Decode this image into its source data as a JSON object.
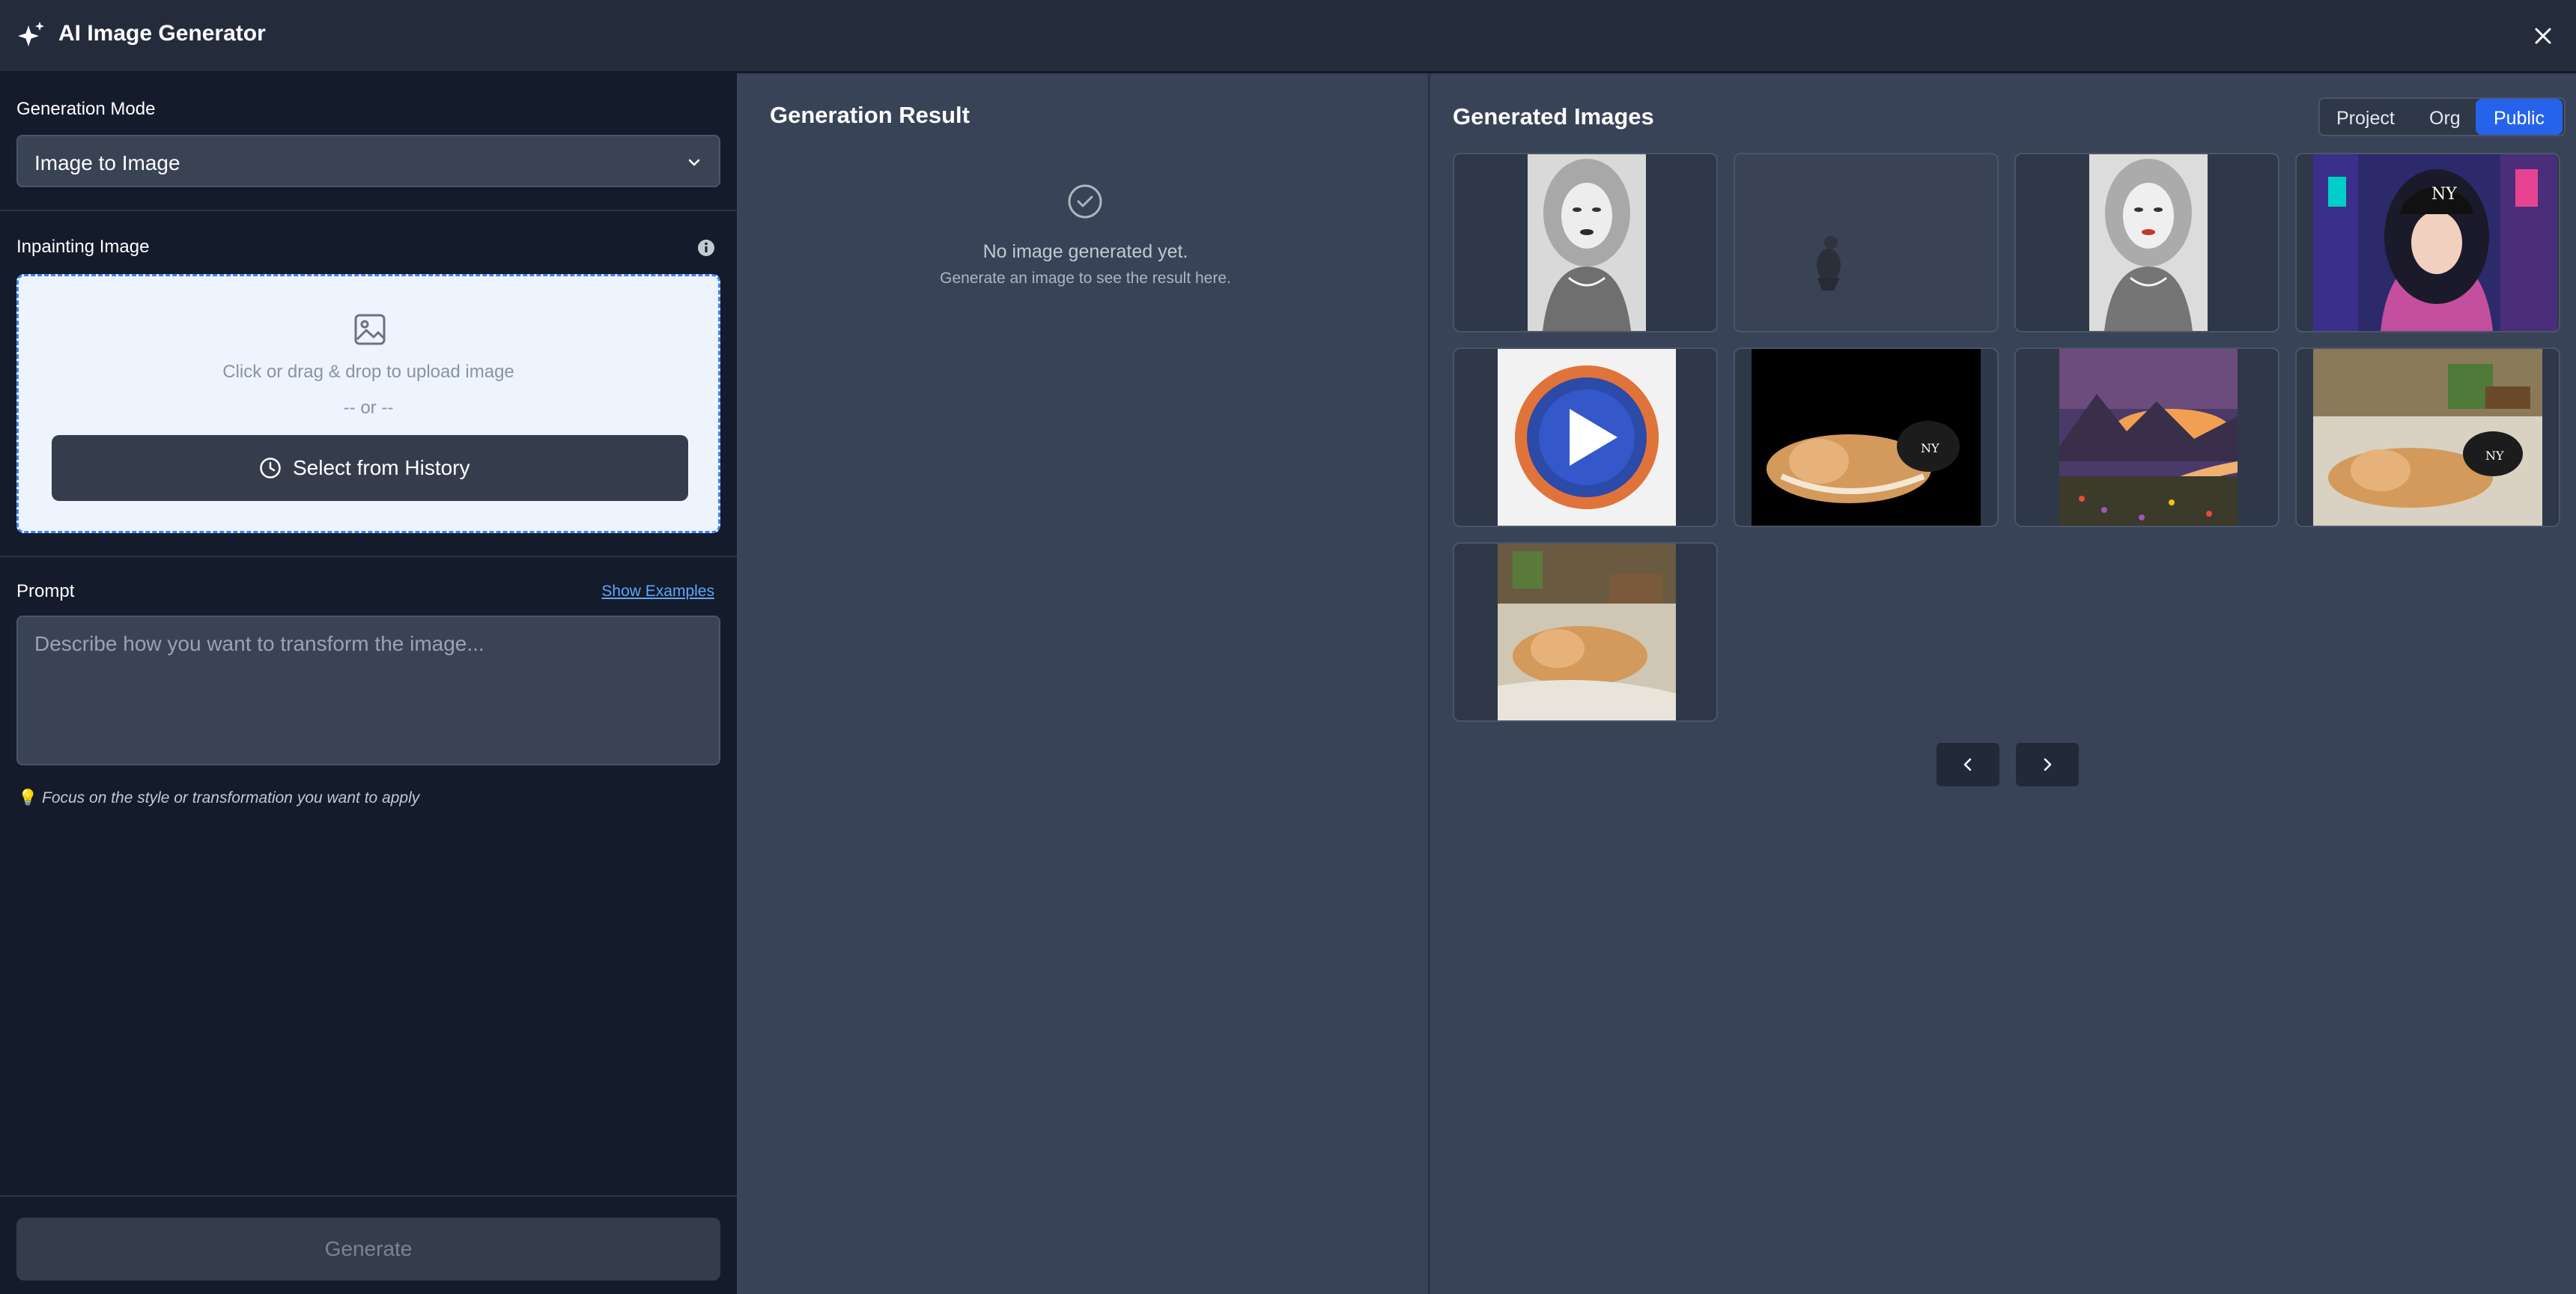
{
  "header": {
    "title": "AI Image Generator"
  },
  "left_panel": {
    "mode_label": "Generation Mode",
    "mode_value": "Image to Image",
    "inpainting_label": "Inpainting Image",
    "upload_hint": "Click or drag & drop to upload image",
    "or_text": "-- or --",
    "history_button": "Select from History",
    "prompt_label": "Prompt",
    "show_examples": "Show Examples",
    "prompt_placeholder": "Describe how you want to transform the image...",
    "tip": "Focus on the style or transformation you want to apply",
    "generate_button": "Generate"
  },
  "result_panel": {
    "title": "Generation Result",
    "empty_title": "No image generated yet.",
    "empty_subtitle": "Generate an image to see the result here."
  },
  "gallery": {
    "title": "Generated Images",
    "scopes": [
      "Project",
      "Org",
      "Public"
    ],
    "active_scope": "Public",
    "thumbnails": [
      {
        "subject": "black-and-white portrait of woman with wavy hair"
      },
      {
        "subject": "small dark figure on grey background"
      },
      {
        "subject": "black-and-white portrait of woman with red lips"
      },
      {
        "subject": "woman in NY cap in neon city street"
      },
      {
        "subject": "blue play button icon with orange ring"
      },
      {
        "subject": "orange cat sleeping with NY cap on black background"
      },
      {
        "subject": "mountain sunset over flower field and river"
      },
      {
        "subject": "orange cat sleeping with NY cap on bed"
      },
      {
        "subject": "orange cat sleeping on bed near window"
      }
    ]
  },
  "colors": {
    "accent": "#2563eb",
    "link": "#60a5fa",
    "upload_border": "#3b82f6"
  }
}
